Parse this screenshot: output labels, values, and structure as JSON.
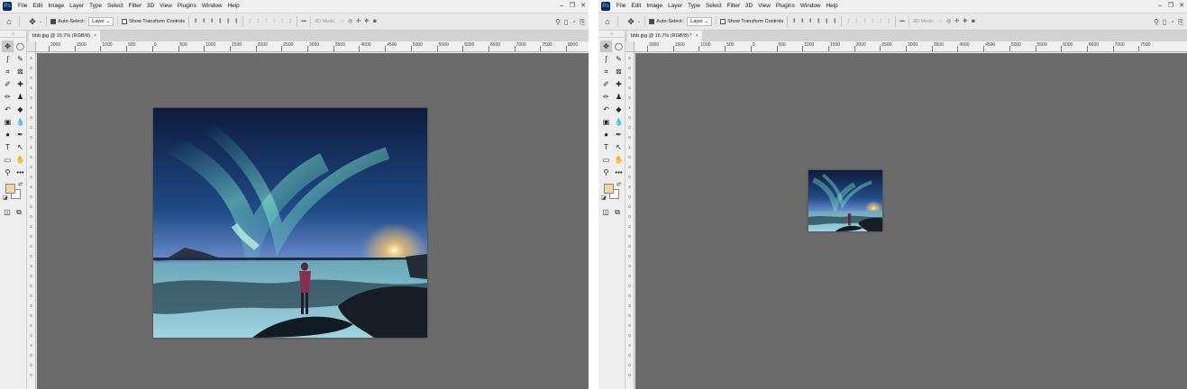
{
  "menu": [
    "File",
    "Edit",
    "Image",
    "Layer",
    "Type",
    "Select",
    "Filter",
    "3D",
    "View",
    "Plugins",
    "Window",
    "Help"
  ],
  "app_logo": "Ps",
  "window_controls": [
    "–",
    "❐",
    "✕"
  ],
  "options": {
    "auto_select_label": "Auto-Select:",
    "auto_select_target": "Layer",
    "show_transform_label": "Show Transform Controls",
    "mode_3d_label": "3D Mode:",
    "more_label": "•••"
  },
  "toolbox_grip": "››",
  "windows": {
    "left": {
      "tab_title": "bbb.jpg @ 16.7% (RGB/8)",
      "tab_close": "×",
      "ruler_labels": [
        "2000",
        "1500",
        "1000",
        "500",
        "0",
        "500",
        "1000",
        "1500",
        "2000",
        "2500",
        "3000",
        "3500",
        "4000",
        "4500",
        "5000",
        "5500",
        "6000",
        "6500",
        "7000",
        "7500",
        "8000"
      ],
      "vruler_labels": [
        "5",
        "0",
        "0",
        "5",
        "0",
        "1",
        "0",
        "0",
        "0",
        "1",
        "5",
        "0",
        "0",
        "2",
        "0",
        "0",
        "0",
        "2",
        "5",
        "0",
        "0",
        "3",
        "0",
        "0",
        "0",
        "3",
        "5",
        "0",
        "0",
        "4",
        "0",
        "0",
        "0"
      ]
    },
    "right": {
      "tab_title": "bbb.jpg @ 16.7% (RGB/8) *",
      "tab_close": "×",
      "ruler_labels": [
        "2000",
        "1500",
        "1000",
        "500",
        "0",
        "500",
        "1000",
        "1500",
        "2000",
        "2500",
        "3000",
        "3500",
        "4000",
        "4500",
        "5000",
        "5500",
        "6000",
        "6500",
        "7000",
        "7500"
      ],
      "vruler_labels": [
        "5",
        "0",
        "0",
        "5",
        "0",
        "1",
        "0",
        "0",
        "0",
        "1",
        "5",
        "0",
        "0",
        "2",
        "0",
        "0",
        "0",
        "2",
        "5",
        "0",
        "0",
        "3",
        "0",
        "0",
        "0",
        "3",
        "5",
        "0",
        "0",
        "4",
        "0",
        "0",
        "0"
      ]
    }
  },
  "tools": [
    {
      "icon": "✥",
      "name": "move-tool-icon"
    },
    {
      "icon": "◯",
      "name": "elliptical-marquee-tool-icon"
    },
    {
      "icon": "ʃ",
      "name": "lasso-tool-icon"
    },
    {
      "icon": "✎",
      "name": "magic-wand-tool-icon"
    },
    {
      "icon": "⌗",
      "name": "crop-tool-icon"
    },
    {
      "icon": "⊠",
      "name": "frame-tool-icon"
    },
    {
      "icon": "✐",
      "name": "eyedropper-tool-icon"
    },
    {
      "icon": "✚",
      "name": "healing-brush-tool-icon"
    },
    {
      "icon": "✏",
      "name": "brush-tool-icon"
    },
    {
      "icon": "♟",
      "name": "clone-stamp-tool-icon"
    },
    {
      "icon": "↶",
      "name": "history-brush-tool-icon"
    },
    {
      "icon": "◆",
      "name": "eraser-tool-icon"
    },
    {
      "icon": "▣",
      "name": "gradient-tool-icon"
    },
    {
      "icon": "💧",
      "name": "blur-tool-icon"
    },
    {
      "icon": "●",
      "name": "dodge-tool-icon"
    },
    {
      "icon": "✒",
      "name": "pen-tool-icon"
    },
    {
      "icon": "T",
      "name": "type-tool-icon"
    },
    {
      "icon": "↖",
      "name": "path-selection-tool-icon"
    },
    {
      "icon": "▭",
      "name": "rectangle-tool-icon"
    },
    {
      "icon": "✋",
      "name": "hand-tool-icon"
    },
    {
      "icon": "⚲",
      "name": "zoom-tool-icon"
    },
    {
      "icon": "•••",
      "name": "edit-toolbar-icon"
    }
  ],
  "colors": {
    "foreground": "#efd9a2",
    "background": "#ffffff",
    "canvas": "#6b6b6b"
  }
}
